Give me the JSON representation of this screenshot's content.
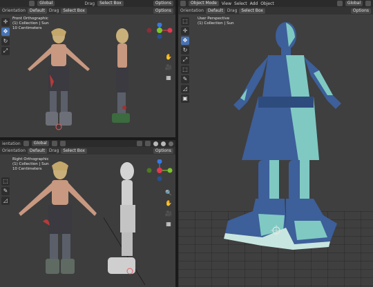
{
  "top_left": {
    "header": {
      "orientation_prefix": "",
      "global_label": "Global",
      "drag_label": "Drag",
      "drag_value": "Select Box",
      "options": "Options"
    },
    "header2": {
      "orientation_label": "Orientation",
      "orientation_value": "Default",
      "drag_label": "Drag",
      "drag_value": "Select Box",
      "options": "Options"
    },
    "info": [
      "Front Orthographic",
      "(1) Collection | Sun",
      "10 Centimeters"
    ]
  },
  "bottom_left": {
    "header": {
      "orientation_prefix": "ientation",
      "global_label": "Global",
      "options": ""
    },
    "header2": {
      "orientation_label": "Orientation",
      "orientation_value": "Default",
      "drag_label": "Drag",
      "drag_value": "Select Box",
      "options": "Options"
    },
    "info": [
      "Right Orthographic",
      "(1) Collection | Sun",
      "10 Centimeters"
    ]
  },
  "right": {
    "header": {
      "mode": "Object Mode",
      "menus": [
        "View",
        "Select",
        "Add",
        "Object"
      ],
      "global_label": "Global"
    },
    "header2": {
      "orientation_label": "Orientation",
      "orientation_value": "Default",
      "drag_label": "Drag",
      "drag_value": "Select Box",
      "options": "Options"
    },
    "info": [
      "User Perspective",
      "(1) Collection | Sun"
    ]
  },
  "gizmo_labels": {
    "x": "X",
    "y": "Y",
    "z": "Z"
  },
  "icons": {
    "tools": [
      "select-box-icon",
      "cursor-icon",
      "move-icon",
      "rotate-icon",
      "scale-icon",
      "transform-icon",
      "annotate-icon",
      "measure-icon",
      "add-cube-icon"
    ],
    "nav": [
      "zoom-icon",
      "hand-icon",
      "camera-icon",
      "grid-icon"
    ]
  },
  "colors": {
    "active_tool": "#4772b3",
    "model_blue": "#3d5f9a",
    "model_light": "#7fc9c2",
    "axis_x": "#e2394f",
    "axis_y": "#7dc52a",
    "axis_z": "#3b78e0"
  }
}
